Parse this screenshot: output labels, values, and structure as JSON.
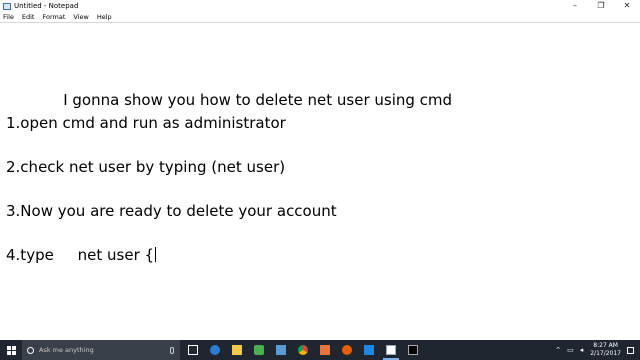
{
  "window": {
    "title": "Untitled - Notepad",
    "controls": {
      "minimize": "–",
      "maximize": "❐",
      "close": "✕"
    }
  },
  "menu": {
    "items": [
      "File",
      "Edit",
      "Format",
      "View",
      "Help"
    ]
  },
  "document": {
    "lines": [
      "            I gonna show you how to delete net user using cmd",
      "1.open cmd and run as administrator",
      "2.check net user by typing (net user)",
      "3.Now you are ready to delete your account",
      "4.type     net user {"
    ]
  },
  "taskbar": {
    "search_placeholder": "Ask me anything",
    "icons": [
      "task-view-icon",
      "edge-icon",
      "file-explorer-icon",
      "app-icon",
      "store-icon",
      "chrome-icon",
      "app-icon",
      "firefox-icon",
      "app-icon",
      "notepad-icon",
      "cmd-icon"
    ],
    "clock_time": "8:27 AM",
    "clock_date": "2/17/2017",
    "colors": {
      "taskbar_bg": "#1f2630",
      "search_bg": "#3a4049"
    }
  }
}
